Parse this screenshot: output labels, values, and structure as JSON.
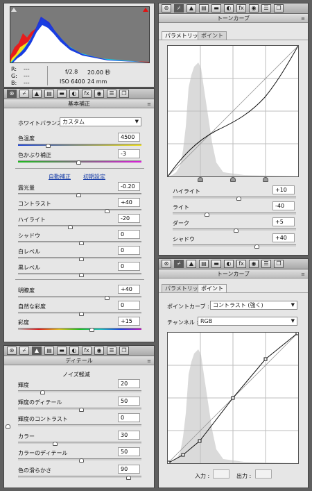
{
  "histogram": {
    "rgb": {
      "r": "R:",
      "g": "G:",
      "b": "B:",
      "r_val": "---",
      "g_val": "---",
      "b_val": "---"
    },
    "exif": {
      "aperture": "f/2.8",
      "shutter": "20.00 秒",
      "iso": "ISO 6400",
      "focal": "24 mm"
    }
  },
  "tab_icons": [
    "aperture-icon",
    "tone-curve-icon",
    "detail-icon",
    "hsl-icon",
    "split-toning-icon",
    "lens-icon",
    "fx-icon",
    "camera-calibration-icon",
    "presets-icon",
    "snapshots-icon"
  ],
  "tab_glyphs": [
    "⊛",
    "⌿",
    "▲",
    "▤",
    "▬",
    "◐",
    "fx",
    "◉",
    "☰",
    "❐"
  ],
  "basic": {
    "title": "基本補正",
    "wb_label": "ホワイトバランス :",
    "wb_value": "カスタム",
    "temp_label": "色温度",
    "temp_value": "4500",
    "tint_label": "色かぶり補正",
    "tint_value": "-3",
    "auto": "自動補正",
    "default": "初期設定",
    "rows": [
      {
        "label": "露光量",
        "value": "-0.20"
      },
      {
        "label": "コントラスト",
        "value": "+40"
      },
      {
        "label": "ハイライト",
        "value": "-20"
      },
      {
        "label": "シャドウ",
        "value": "0"
      },
      {
        "label": "白レベル",
        "value": "0"
      },
      {
        "label": "黒レベル",
        "value": "0"
      }
    ],
    "presence": [
      {
        "label": "明瞭度",
        "value": "+40"
      },
      {
        "label": "自然な彩度",
        "value": "0"
      },
      {
        "label": "彩度",
        "value": "+15"
      }
    ]
  },
  "detail": {
    "title": "ディテール",
    "section": "ノイズ軽減",
    "rows": [
      {
        "label": "輝度",
        "value": "20"
      },
      {
        "label": "輝度のディテール",
        "value": "50"
      },
      {
        "label": "輝度のコントラスト",
        "value": "0"
      },
      {
        "label": "カラー",
        "value": "30"
      },
      {
        "label": "カラーのディテール",
        "value": "50"
      },
      {
        "label": "色の滑らかさ",
        "value": "90"
      }
    ]
  },
  "curve_top": {
    "title": "トーンカーブ",
    "tab_param": "パラメトリック",
    "tab_point": "ポイント",
    "rows": [
      {
        "label": "ハイライト",
        "value": "+10"
      },
      {
        "label": "ライト",
        "value": "-40"
      },
      {
        "label": "ダーク",
        "value": "+5"
      },
      {
        "label": "シャドウ",
        "value": "+40"
      }
    ]
  },
  "curve_bottom": {
    "title": "トーンカーブ",
    "tab_param": "パラメトリック",
    "tab_point": "ポイント",
    "pointcurve_label": "ポイントカーブ :",
    "pointcurve_value": "コントラスト (強く)",
    "channel_label": "チャンネル :",
    "channel_value": "RGB",
    "input_label": "入力 :",
    "output_label": "出力 :"
  },
  "colors": {
    "panel_bg": "#e6e6e6",
    "link": "#1a3fa8",
    "histogram_bg": "#7a7a7a"
  }
}
